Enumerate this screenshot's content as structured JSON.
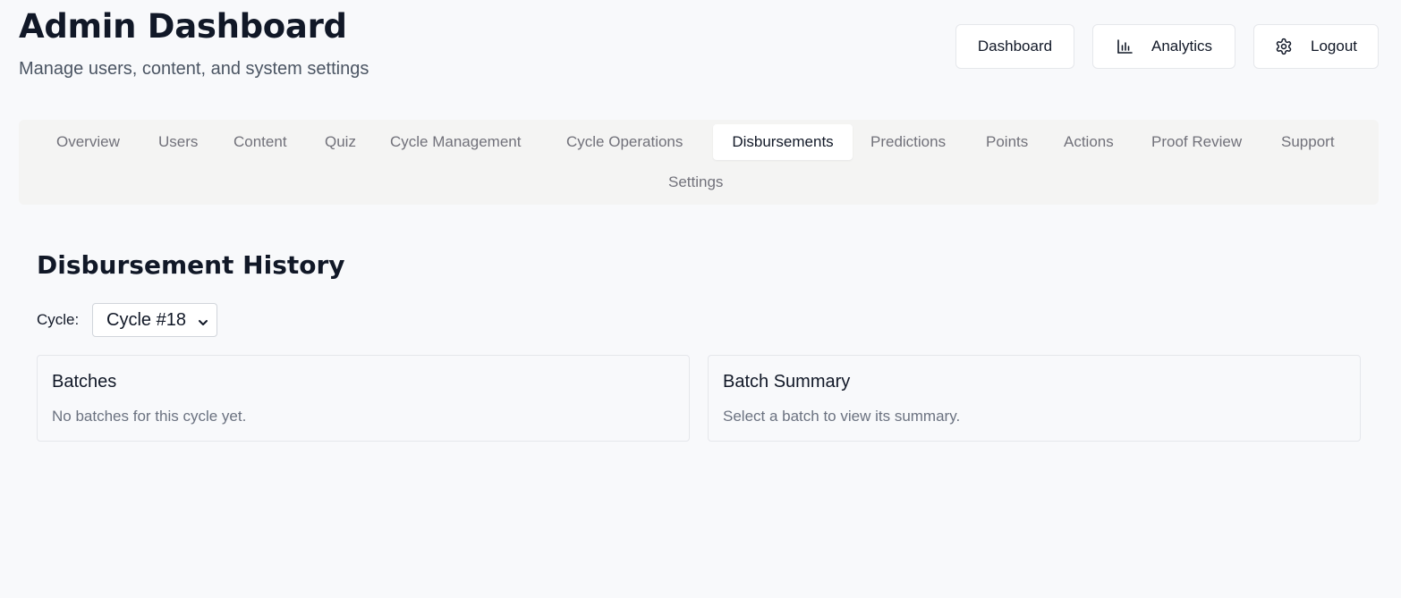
{
  "header": {
    "title": "Admin Dashboard",
    "subtitle": "Manage users, content, and system settings",
    "buttons": {
      "dashboard": "Dashboard",
      "analytics": "Analytics",
      "logout": "Logout"
    },
    "icons": {
      "analytics": "bar-chart-icon",
      "logout": "gear-icon"
    }
  },
  "tabs": {
    "items": [
      {
        "label": "Overview"
      },
      {
        "label": "Users"
      },
      {
        "label": "Content"
      },
      {
        "label": "Quiz"
      },
      {
        "label": "Cycle Management"
      },
      {
        "label": "Cycle Operations"
      },
      {
        "label": "Disbursements"
      },
      {
        "label": "Predictions"
      },
      {
        "label": "Points"
      },
      {
        "label": "Actions"
      },
      {
        "label": "Proof Review"
      },
      {
        "label": "Support"
      },
      {
        "label": "Settings"
      }
    ],
    "active": "Disbursements"
  },
  "main": {
    "title": "Disbursement History",
    "cycle_label": "Cycle:",
    "cycle_value": "Cycle #18",
    "batches": {
      "title": "Batches",
      "empty_text": "No batches for this cycle yet."
    },
    "summary": {
      "title": "Batch Summary",
      "empty_text": "Select a batch to view its summary."
    }
  },
  "colors": {
    "background": "#f8f9fb",
    "tab_bar": "#f4f4f3",
    "text_primary": "#111827",
    "text_muted": "#6b7280"
  }
}
